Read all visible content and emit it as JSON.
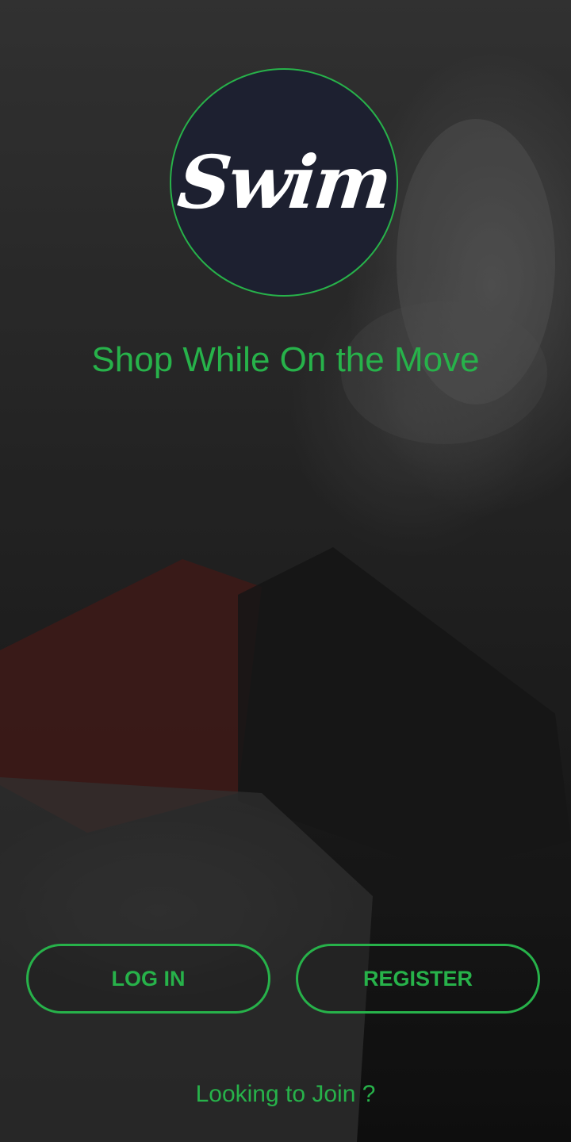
{
  "app": {
    "logo_text": "Swim",
    "tagline": "Shop While On the Move"
  },
  "actions": {
    "login_label": "LOG IN",
    "register_label": "REGISTER",
    "join_link": "Looking to Join ?"
  },
  "colors": {
    "accent": "#27b24a",
    "logo_bg": "#1d2030",
    "text_light": "#ffffff"
  }
}
